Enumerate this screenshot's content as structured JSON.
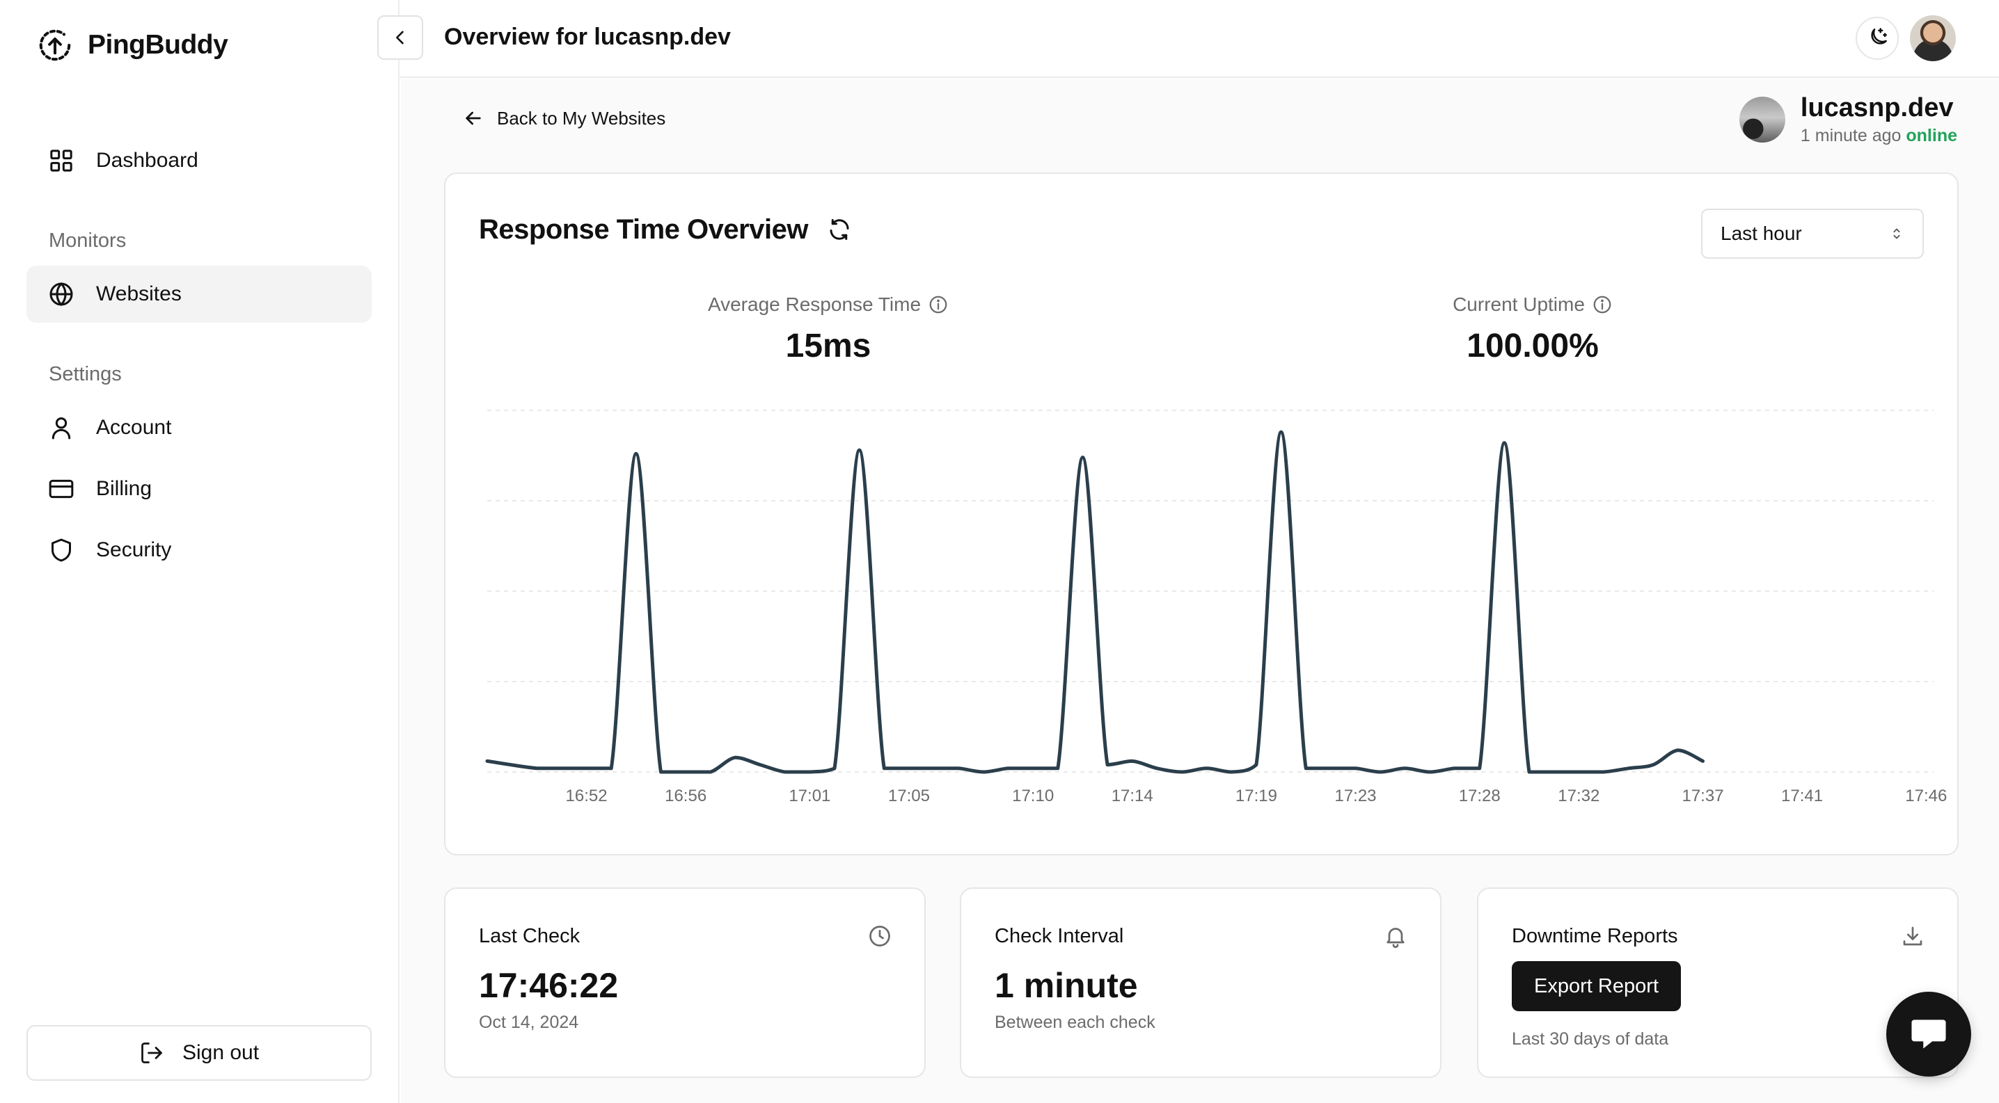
{
  "app": {
    "name": "PingBuddy",
    "logo_icon": "upload-circle-icon"
  },
  "sidebar": {
    "dashboard": {
      "label": "Dashboard",
      "icon": "grid-icon"
    },
    "monitors_section": "Monitors",
    "websites": {
      "label": "Websites",
      "icon": "globe-icon",
      "active": true
    },
    "settings_section": "Settings",
    "account": {
      "label": "Account",
      "icon": "user-icon"
    },
    "billing": {
      "label": "Billing",
      "icon": "credit-card-icon"
    },
    "security": {
      "label": "Security",
      "icon": "shield-icon"
    },
    "signout": {
      "label": "Sign out",
      "icon": "logout-icon"
    }
  },
  "header": {
    "title": "Overview for lucasnp.dev",
    "theme_icon": "moon-stars-icon",
    "collapse_icon": "chevron-left-icon"
  },
  "back": {
    "label": "Back to My Websites",
    "icon": "arrow-left-icon"
  },
  "site": {
    "name": "lucasnp.dev",
    "last_seen": "1 minute ago",
    "status": "online",
    "status_color": "#22a35a"
  },
  "overview": {
    "title": "Response Time Overview",
    "refresh_icon": "refresh-icon",
    "range": "Last hour",
    "avg_label": "Average Response Time",
    "avg_value": "15ms",
    "uptime_label": "Current Uptime",
    "uptime_value": "100.00%"
  },
  "chart_data": {
    "type": "line",
    "x_ticks": [
      "16:52",
      "16:56",
      "17:01",
      "17:05",
      "17:10",
      "17:14",
      "17:19",
      "17:23",
      "17:28",
      "17:32",
      "17:37",
      "17:41",
      "17:46"
    ],
    "line_color": "#2b3e4b",
    "grid": "dashed horizontal",
    "series": [
      {
        "points": [
          [
            "16:48",
            3
          ],
          [
            "16:50",
            1
          ],
          [
            "16:51",
            1
          ],
          [
            "16:52",
            1
          ],
          [
            "16:53",
            1
          ],
          [
            "16:54",
            88
          ],
          [
            "16:55",
            0
          ],
          [
            "16:56",
            0
          ],
          [
            "16:57",
            0
          ],
          [
            "16:58",
            4
          ],
          [
            "16:59",
            2
          ],
          [
            "17:00",
            0
          ],
          [
            "17:01",
            0
          ],
          [
            "17:02",
            1
          ],
          [
            "17:03",
            89
          ],
          [
            "17:04",
            1
          ],
          [
            "17:05",
            1
          ],
          [
            "17:06",
            1
          ],
          [
            "17:07",
            1
          ],
          [
            "17:08",
            0
          ],
          [
            "17:09",
            1
          ],
          [
            "17:10",
            1
          ],
          [
            "17:11",
            1
          ],
          [
            "17:12",
            87
          ],
          [
            "17:13",
            2
          ],
          [
            "17:14",
            3
          ],
          [
            "17:15",
            1
          ],
          [
            "17:16",
            0
          ],
          [
            "17:17",
            1
          ],
          [
            "17:18",
            0
          ],
          [
            "17:19",
            2
          ],
          [
            "17:20",
            94
          ],
          [
            "17:21",
            1
          ],
          [
            "17:22",
            1
          ],
          [
            "17:23",
            1
          ],
          [
            "17:24",
            0
          ],
          [
            "17:25",
            1
          ],
          [
            "17:26",
            0
          ],
          [
            "17:27",
            1
          ],
          [
            "17:28",
            1
          ],
          [
            "17:29",
            91
          ],
          [
            "17:30",
            0
          ],
          [
            "17:31",
            0
          ],
          [
            "17:32",
            0
          ],
          [
            "17:33",
            0
          ],
          [
            "17:34",
            1
          ],
          [
            "17:35",
            2
          ],
          [
            "17:36",
            6
          ],
          [
            "17:37",
            3
          ]
        ]
      }
    ]
  },
  "cards": {
    "last_check": {
      "label": "Last Check",
      "icon": "clock-icon",
      "value": "17:46:22",
      "sub": "Oct 14, 2024"
    },
    "interval": {
      "label": "Check Interval",
      "icon": "bell-icon",
      "value": "1 minute",
      "sub": "Between each check"
    },
    "downtime": {
      "label": "Downtime Reports",
      "icon": "download-icon",
      "button": "Export Report",
      "sub": "Last 30 days of data"
    }
  },
  "chat": {
    "icon": "chat-bubble-icon"
  }
}
